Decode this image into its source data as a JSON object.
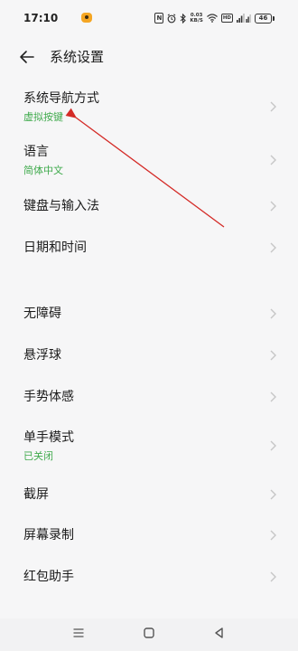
{
  "status_bar": {
    "time": "17:10",
    "nfc_label": "N",
    "net_speed_value": "0.03",
    "net_speed_unit": "KB/S",
    "hd_label": "HD",
    "battery_level": "46",
    "icons": [
      "app-notification-icon",
      "nfc-icon",
      "alarm-icon",
      "bluetooth-icon",
      "wifi-icon",
      "hd-icon",
      "signal-icon",
      "battery-icon"
    ]
  },
  "header": {
    "title": "系统设置",
    "back_icon": "back-arrow-icon"
  },
  "groups": [
    {
      "items": [
        {
          "label": "系统导航方式",
          "value": "虚拟按键"
        },
        {
          "label": "语言",
          "value": "简体中文"
        },
        {
          "label": "键盘与输入法"
        },
        {
          "label": "日期和时间"
        }
      ]
    },
    {
      "items": [
        {
          "label": "无障碍"
        },
        {
          "label": "悬浮球"
        },
        {
          "label": "手势体感"
        },
        {
          "label": "单手模式",
          "value": "已关闭"
        },
        {
          "label": "截屏"
        },
        {
          "label": "屏幕录制"
        },
        {
          "label": "红包助手"
        }
      ]
    }
  ],
  "row_icon": "chevron-right-icon",
  "nav_bar": {
    "icons": [
      "menu-icon",
      "home-icon",
      "back-triangle-icon"
    ]
  },
  "colors": {
    "background": "#f6f6f7",
    "value_text": "#3faa4c",
    "annotation_arrow": "#d42a26"
  }
}
